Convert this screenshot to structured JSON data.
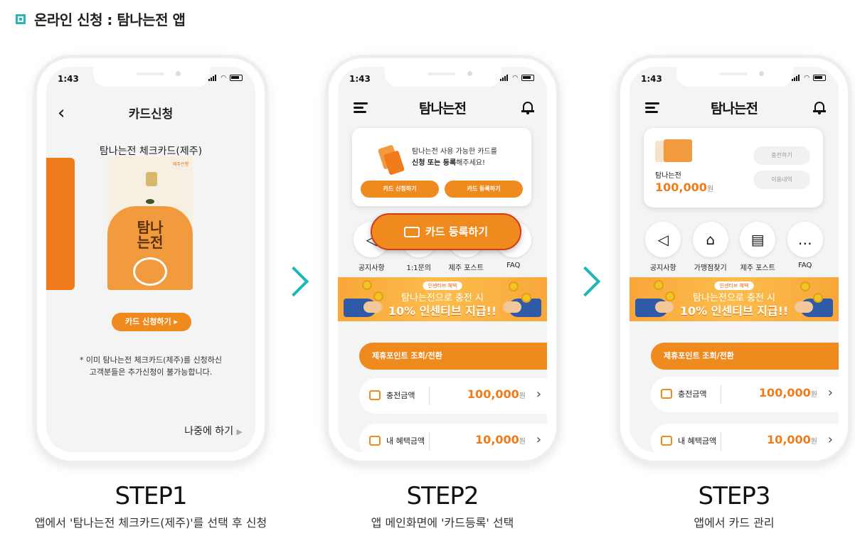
{
  "header": {
    "title": "온라인 신청 : 탐나는전 앱"
  },
  "status": {
    "time": "1:43"
  },
  "phone1": {
    "screen_title": "카드신청",
    "card_name": "탐나는전 체크카드(제주)",
    "card_bank_label": "제주은행",
    "card_logo": "탐나\n는전",
    "apply_button": "카드 신청하기",
    "note_line1": "* 이미 탐나는전 체크카드(제주)를 신청하신",
    "note_line2": "고객분들은 추가신청이 불가능합니다.",
    "later_link": "나중에 하기"
  },
  "phone2": {
    "brand": "탐나는전",
    "promo_line1": "탐나는전 사용 가능한 카드를",
    "promo_line2_bold": "신청 또는 등록",
    "promo_line2_rest": "해주세요!",
    "apply_button": "카드 신청하기",
    "register_button": "카드 등록하기",
    "callout": "카드 등록하기",
    "menu": [
      "공지사항",
      "1:1문의",
      "제주 포스트",
      "FAQ"
    ],
    "banner_tag": "인센티브 혜택",
    "banner_line1": "탐나는전으로 충전 시",
    "banner_line2": "10% 인센티브 지급!!",
    "points_tab": "제휴포인트 조회/전환",
    "rows": [
      {
        "label": "충전금액",
        "value": "100,000",
        "unit": "원"
      },
      {
        "label": "내 혜택금액",
        "value": "10,000",
        "unit": "원"
      }
    ]
  },
  "phone3": {
    "brand": "탐나는전",
    "card_label": "탐나는전",
    "balance": "100,000",
    "balance_unit": "원",
    "charge_button": "충전하기",
    "history_button": "이용내역",
    "menu": [
      "공지사항",
      "가맹점찾기",
      "제주 포스트",
      "FAQ"
    ],
    "banner_tag": "인센티브 혜택",
    "banner_line1": "탐나는전으로 충전 시",
    "banner_line2": "10% 인센티브 지급!!",
    "points_tab": "제휴포인트 조회/전환",
    "rows": [
      {
        "label": "충전금액",
        "value": "100,000",
        "unit": "원"
      },
      {
        "label": "내 혜택금액",
        "value": "10,000",
        "unit": "원"
      }
    ]
  },
  "steps": [
    {
      "title": "STEP1",
      "desc": "앱에서 '탐나는전 체크카드(제주)'를 선택 후 신청"
    },
    {
      "title": "STEP2",
      "desc": "앱 메인화면에 '카드등록' 선택"
    },
    {
      "title": "STEP3",
      "desc": "앱에서 카드 관리"
    }
  ],
  "colors": {
    "accent": "#ef8a1f",
    "teal": "#1fb7b7",
    "highlight_border": "#d23a1c"
  }
}
